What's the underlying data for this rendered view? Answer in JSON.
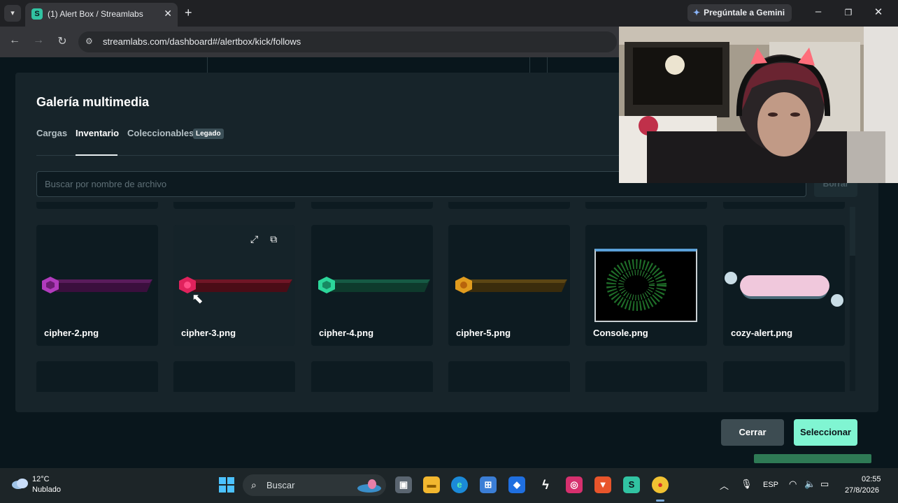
{
  "browser": {
    "tab_title": "(1) Alert Box / Streamlabs",
    "tab_favicon": "streamlabs-icon",
    "new_tab_glyph": "+",
    "gemini_label": "Pregúntale a Gemini",
    "url": "streamlabs.com/dashboard#/alertbox/kick/follows"
  },
  "modal": {
    "title": "Galería multimedia",
    "tabs": [
      {
        "label": "Cargas",
        "active": false
      },
      {
        "label": "Inventario",
        "active": true
      },
      {
        "label": "Coleccionables",
        "active": false
      }
    ],
    "legacy_badge": "Legado",
    "search_placeholder": "Buscar por nombre de archivo",
    "clear_label": "Borrar",
    "files": [
      {
        "name": "cipher-2.png",
        "accent": "#b13bbd"
      },
      {
        "name": "cipher-3.png",
        "accent": "#e0225c"
      },
      {
        "name": "cipher-4.png",
        "accent": "#2cd69a"
      },
      {
        "name": "cipher-5.png",
        "accent": "#e09b1e"
      },
      {
        "name": "Console.png",
        "accent": "#2f8f3a"
      },
      {
        "name": "cozy-alert.png",
        "accent": "#f0b9d3"
      }
    ],
    "close_label": "Cerrar",
    "select_label": "Seleccionar"
  },
  "taskbar": {
    "weather_temp": "12°C",
    "weather_desc": "Nublado",
    "search_label": "Buscar",
    "language": "ESP",
    "time": "02:55",
    "date": "27/8/2026"
  },
  "colors": {
    "accent": "#80f5d2",
    "modal_bg": "#17242a",
    "card_bg": "#0d1b21"
  }
}
